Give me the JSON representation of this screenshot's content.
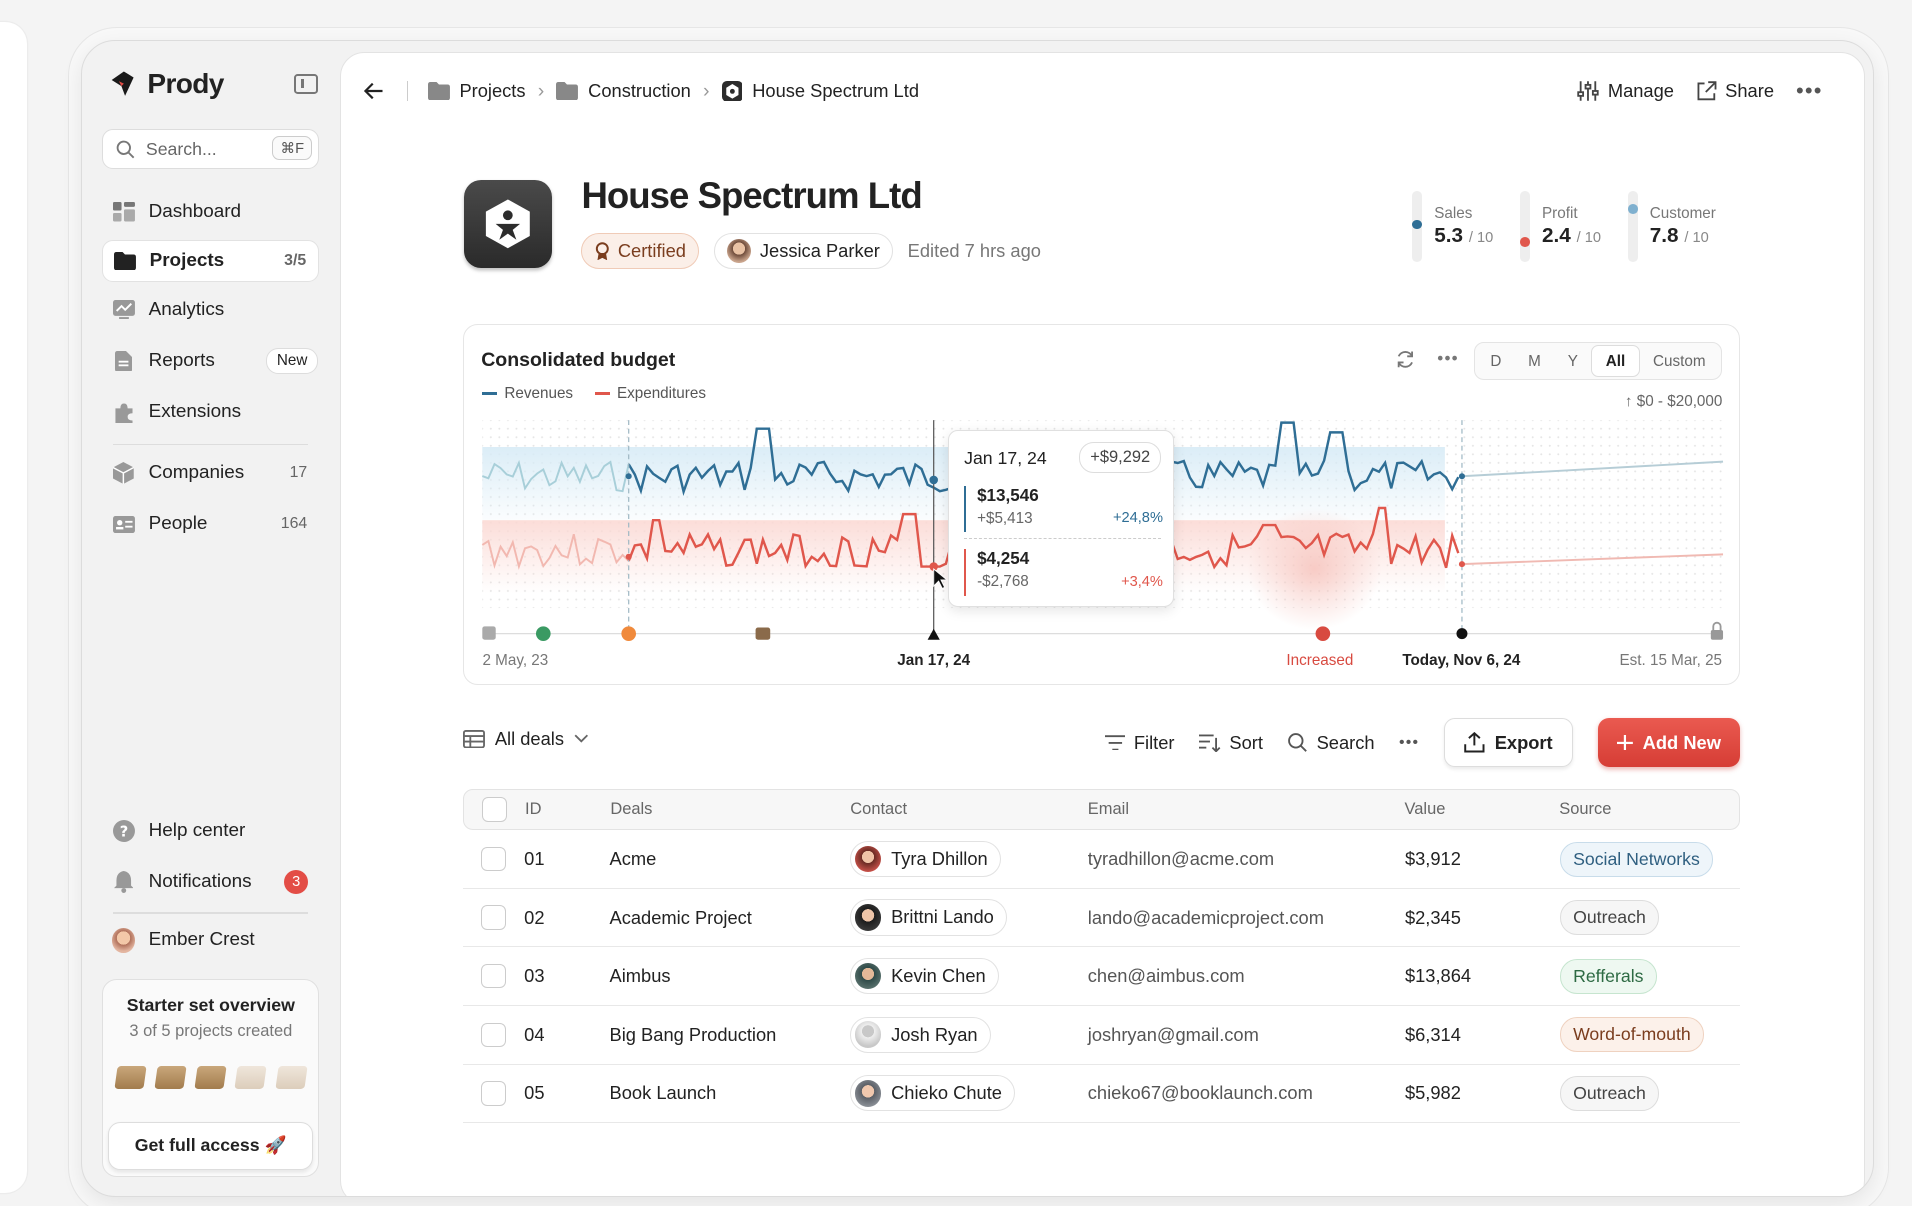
{
  "app": {
    "name": "Prody"
  },
  "search": {
    "placeholder": "Search...",
    "shortcut": "⌘F"
  },
  "sidebar": {
    "items": [
      {
        "label": "Dashboard",
        "icon": "dashboard-icon"
      },
      {
        "label": "Projects",
        "count": "3/5",
        "icon": "folder-icon"
      },
      {
        "label": "Analytics",
        "icon": "analytics-icon"
      },
      {
        "label": "Reports",
        "badge": "New",
        "icon": "report-icon"
      },
      {
        "label": "Extensions",
        "icon": "puzzle-icon"
      },
      {
        "label": "Companies",
        "count": "17",
        "icon": "cube-icon"
      },
      {
        "label": "People",
        "count": "164",
        "icon": "id-card-icon"
      }
    ],
    "help": "Help center",
    "notifications": {
      "label": "Notifications",
      "count": "3"
    },
    "user": "Ember Crest",
    "starter": {
      "title": "Starter set overview",
      "subtitle": "3 of 5 projects created",
      "button": "Get full access 🚀"
    }
  },
  "breadcrumb": [
    "Projects",
    "Construction",
    "House Spectrum Ltd"
  ],
  "topbar": {
    "manage": "Manage",
    "share": "Share"
  },
  "header": {
    "title": "House Spectrum Ltd",
    "certified": "Certified",
    "owner": "Jessica Parker",
    "edited": "Edited 7 hrs ago"
  },
  "metrics": [
    {
      "label": "Sales",
      "value": "5.3",
      "max": "/ 10",
      "level": 0.53,
      "color": "#2f6e95"
    },
    {
      "label": "Profit",
      "value": "2.4",
      "max": "/ 10",
      "level": 0.24,
      "color": "#e0574c"
    },
    {
      "label": "Customer",
      "value": "7.8",
      "max": "/ 10",
      "level": 0.78,
      "color": "#7fb0cf"
    }
  ],
  "chart": {
    "title": "Consolidated budget",
    "legend": [
      "Revenues",
      "Expenditures"
    ],
    "ranges": [
      "D",
      "M",
      "Y",
      "All",
      "Custom"
    ],
    "selected_range": "All",
    "ylim_label": "↑ $0 - $20,000",
    "xlabels": [
      "2 May, 23",
      "Jan 17, 24",
      "Increased",
      "Today, Nov 6, 24",
      "Est. 15 Mar, 25"
    ],
    "tooltip": {
      "date": "Jan 17, 24",
      "delta": "+$9,292",
      "rev_value": "$13,546",
      "rev_sub": "+$5,413",
      "rev_pct": "+24,8%",
      "exp_value": "$4,254",
      "exp_sub": "-$2,768",
      "exp_pct": "+3,4%"
    },
    "colors": {
      "revenue": "#2f6e95",
      "expenditure": "#e0574c"
    }
  },
  "deals": {
    "view": "All deals",
    "filter": "Filter",
    "sort": "Sort",
    "search": "Search",
    "export": "Export",
    "add": "Add New",
    "columns": [
      "ID",
      "Deals",
      "Contact",
      "Email",
      "Value",
      "Source"
    ],
    "rows": [
      {
        "id": "01",
        "deal": "Acme",
        "contact": "Tyra Dhillon",
        "email": "tyradhillon@acme.com",
        "value": "$3,912",
        "source": "Social Networks"
      },
      {
        "id": "02",
        "deal": "Academic Project",
        "contact": "Brittni Lando",
        "email": "lando@academicproject.com",
        "value": "$2,345",
        "source": "Outreach"
      },
      {
        "id": "03",
        "deal": "Aimbus",
        "contact": "Kevin Chen",
        "email": "chen@aimbus.com",
        "value": "$13,864",
        "source": "Refferals"
      },
      {
        "id": "04",
        "deal": "Big Bang Production",
        "contact": "Josh Ryan",
        "email": "joshryan@gmail.com",
        "value": "$6,314",
        "source": "Word-of-mouth"
      },
      {
        "id": "05",
        "deal": "Book Launch",
        "contact": "Chieko Chute",
        "email": "chieko67@booklaunch.com",
        "value": "$5,982",
        "source": "Outreach"
      }
    ]
  }
}
